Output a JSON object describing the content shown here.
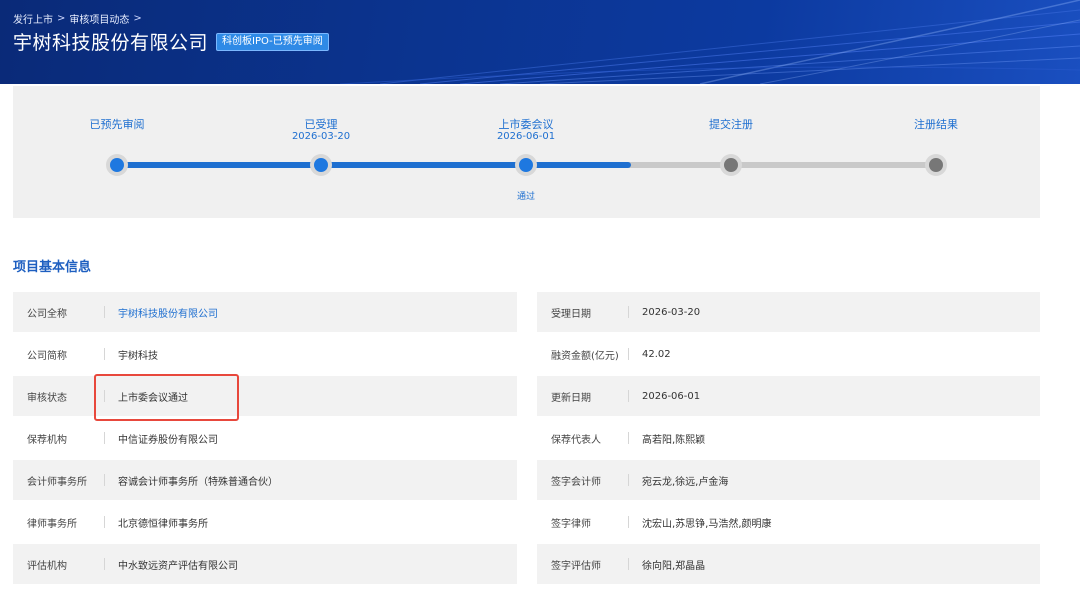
{
  "breadcrumb": {
    "item1": "发行上市",
    "sep1": ">",
    "item2": "审核项目动态",
    "sep2": ">"
  },
  "header": {
    "title": "宇树科技股份有限公司",
    "badge": "科创板IPO-已预先审阅"
  },
  "progress": {
    "steps": [
      {
        "label": "已预先审阅",
        "date": "",
        "state": "done"
      },
      {
        "label": "已受理",
        "date": "2026-03-20",
        "state": "done"
      },
      {
        "label": "上市委会议",
        "date": "2026-06-01",
        "state": "done",
        "result": "通过"
      },
      {
        "label": "提交注册",
        "date": "",
        "state": "pending"
      },
      {
        "label": "注册结果",
        "date": "",
        "state": "pending"
      }
    ],
    "colors": {
      "done": "#1e78e0",
      "pending": "#777777"
    }
  },
  "section": {
    "title": "项目基本信息"
  },
  "info": {
    "left": [
      {
        "label": "公司全称",
        "value": "宇树科技股份有限公司"
      },
      {
        "label": "公司简称",
        "value": "宇树科技"
      },
      {
        "label": "审核状态",
        "value": "上市委会议通过"
      },
      {
        "label": "保荐机构",
        "value": "中信证券股份有限公司"
      },
      {
        "label": "会计师事务所",
        "value": "容诚会计师事务所（特殊普通合伙）"
      },
      {
        "label": "律师事务所",
        "value": "北京德恒律师事务所"
      },
      {
        "label": "评估机构",
        "value": "中水致远资产评估有限公司"
      }
    ],
    "right": [
      {
        "label": "受理日期",
        "value": "2026-03-20"
      },
      {
        "label": "融资金额(亿元)",
        "value": "42.02"
      },
      {
        "label": "更新日期",
        "value": "2026-06-01"
      },
      {
        "label": "保荐代表人",
        "value": "高若阳,陈熙颖"
      },
      {
        "label": "签字会计师",
        "value": "宛云龙,徐远,卢金海"
      },
      {
        "label": "签字律师",
        "value": "沈宏山,苏思铮,马浩然,颜明康"
      },
      {
        "label": "签字评估师",
        "value": "徐向阳,郑晶晶"
      }
    ]
  }
}
